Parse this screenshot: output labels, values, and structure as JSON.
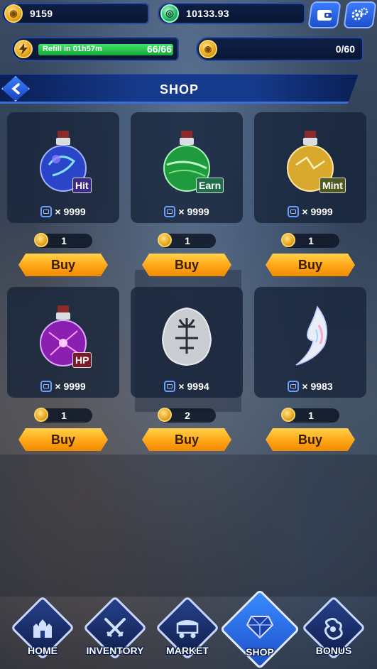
{
  "currency": {
    "gold": "9159",
    "green": "10133.93"
  },
  "energy": {
    "refill_text": "Refill in 01h57m",
    "value": "66/66",
    "fill_fraction": 1.0
  },
  "coins": {
    "value": "0/60"
  },
  "header": {
    "title": "SHOP"
  },
  "items": [
    {
      "tag": "Hit",
      "stock": "9999",
      "price": "1",
      "buy": "Buy",
      "icon": "blue-potion-icon",
      "color": "#3a6dff"
    },
    {
      "tag": "Earn",
      "stock": "9999",
      "price": "1",
      "buy": "Buy",
      "icon": "green-potion-icon",
      "color": "#2fbf5a"
    },
    {
      "tag": "Mint",
      "stock": "9999",
      "price": "1",
      "buy": "Buy",
      "icon": "gold-potion-icon",
      "color": "#e3b43a"
    },
    {
      "tag": "HP",
      "stock": "9999",
      "price": "1",
      "buy": "Buy",
      "icon": "purple-potion-icon",
      "color": "#b42bd8"
    },
    {
      "tag": "",
      "stock": "9994",
      "price": "2",
      "buy": "Buy",
      "icon": "rune-stone-icon",
      "color": "#cfd3d6"
    },
    {
      "tag": "",
      "stock": "9983",
      "price": "1",
      "buy": "Buy",
      "icon": "crystal-shard-icon",
      "color": "#e6ecff"
    }
  ],
  "nav": [
    {
      "label": "HOME",
      "icon": "castle-icon"
    },
    {
      "label": "INVENTORY",
      "icon": "crossed-swords-icon"
    },
    {
      "label": "MARKET",
      "icon": "market-cart-icon"
    },
    {
      "label": "SHOP",
      "icon": "gem-icon",
      "active": true
    },
    {
      "label": "BONUS",
      "icon": "bonus-icon"
    }
  ]
}
